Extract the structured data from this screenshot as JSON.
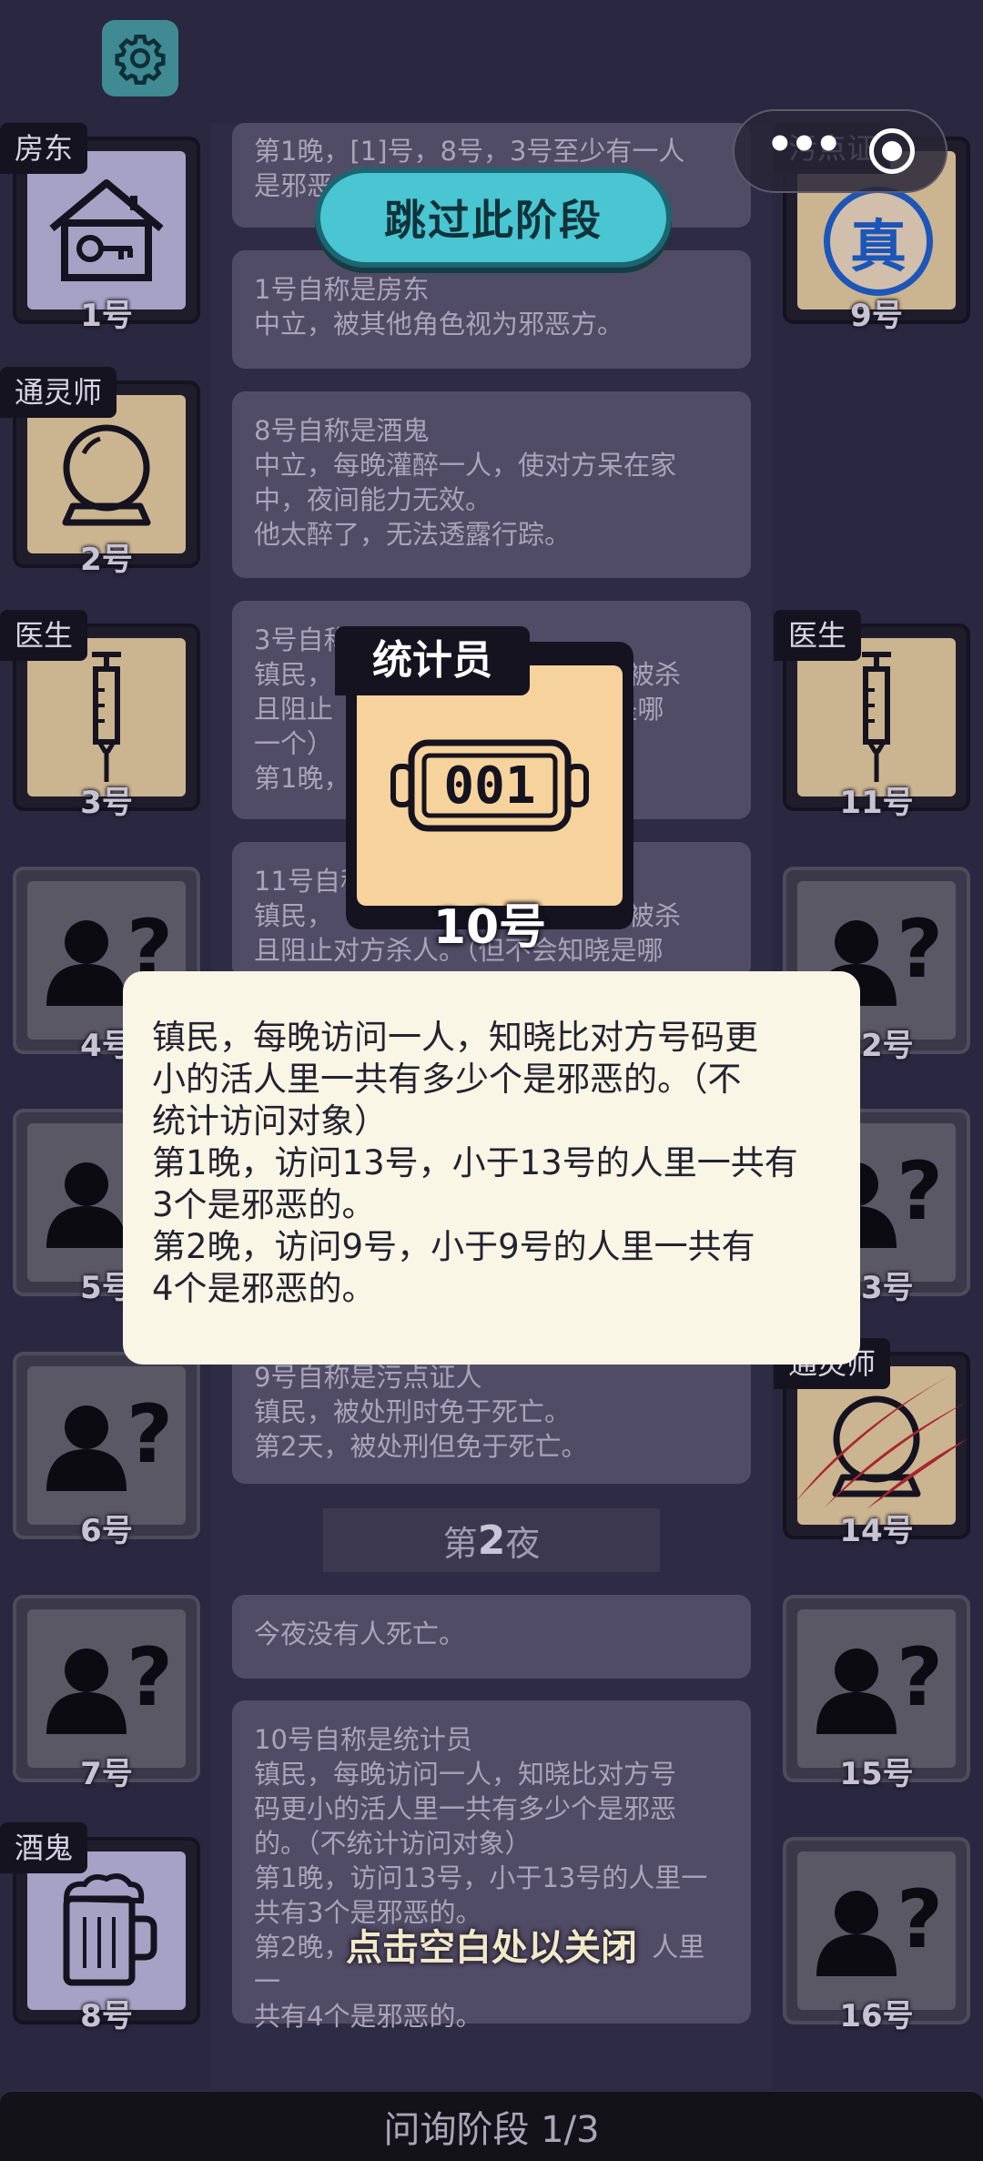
{
  "top": {
    "settings_icon": "gear-icon",
    "capsule_more_icon": "dots",
    "capsule_close_icon": "target-icon"
  },
  "skip_button": "跳过此阶段",
  "players": {
    "p1": {
      "number": "1号",
      "role": "房东",
      "icon": "house-key-icon"
    },
    "p2": {
      "number": "2号",
      "role": "通灵师",
      "icon": "crystal-ball-icon"
    },
    "p3": {
      "number": "3号",
      "role": "医生",
      "icon": "syringe-icon"
    },
    "p4": {
      "number": "4号"
    },
    "p5": {
      "number": "5号"
    },
    "p6": {
      "number": "6号"
    },
    "p7": {
      "number": "7号"
    },
    "p8": {
      "number": "8号",
      "role": "酒鬼",
      "icon": "beer-mug-icon"
    },
    "p9": {
      "number": "9号",
      "role": "污点证",
      "icon": "real-badge-icon",
      "badge": "真"
    },
    "p11": {
      "number": "11号",
      "role": "医生",
      "icon": "syringe-icon"
    },
    "p12": {
      "number": "12号"
    },
    "p13": {
      "number": "13号"
    },
    "p14": {
      "number": "14号",
      "role": "通灵师",
      "icon": "claw-slash-icon"
    },
    "p15": {
      "number": "15号"
    },
    "p16": {
      "number": "16号"
    }
  },
  "log": {
    "card0": "第1晚，[1]号，8号，3号至少有一人\n是邪恶",
    "card1": "1号自称是房东\n中立，被其他角色视为邪恶方。",
    "card2": "8号自称是酒鬼\n中立，每晚灌醉一人，使对方呆在家\n中，夜间能力无效。\n他太醉了，无法透露行踪。",
    "card3": "3号自称\n镇民，                                方被杀\n且阻止                              晚是哪\n一个）\n第1晚，",
    "card4": "11号自称\n镇民，                                方被杀\n且阻止对方杀人。（但不会知晓是哪",
    "card5": "9号自称是污点证人\n镇民，被处刑时免于死亡。\n第2天，被处刑但免于死亡。",
    "night_prefix": "第",
    "night_num": "2",
    "night_suffix": "夜",
    "card6": "今夜没有人死亡。",
    "card7": "10号自称是统计员\n镇民，每晚访问一人，知晓比对方号\n码更小的活人里一共有多少个是邪恶\n的。（不统计访问对象）\n第1晚，访问13号，小于13号的人里一\n共有3个是邪恶的。\n第2晚，                                    人里一\n共有4个是邪恶的。"
  },
  "statistician": {
    "role": "统计员",
    "number": "10号",
    "counter": "001",
    "icon": "counter-icon"
  },
  "popup": {
    "text": "镇民，每晚访问一人，知晓比对方号码更\n小的活人里一共有多少个是邪恶的。（不\n统计访问对象）\n第1晚，访问13号，小于13号的人里一共有\n3个是邪恶的。\n第2晚，访问9号，小于9号的人里一共有\n4个是邪恶的。"
  },
  "close_hint": "点击空白处以关闭",
  "bottom_bar": "问询阶段 1/3"
}
